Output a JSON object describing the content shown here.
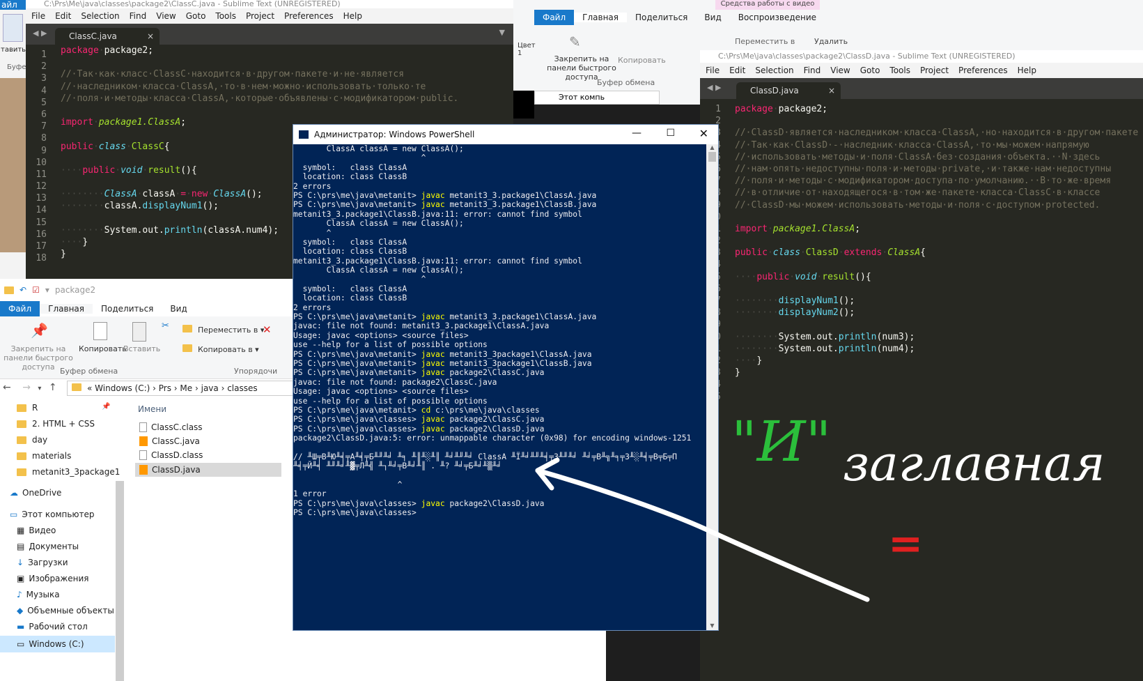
{
  "left_sublime": {
    "title": "C:\\Prs\\Me\\java\\classes\\package2\\ClassC.java - Sublime Text (UNREGISTERED)",
    "menu": [
      "File",
      "Edit",
      "Selection",
      "Find",
      "View",
      "Goto",
      "Tools",
      "Project",
      "Preferences",
      "Help"
    ],
    "tab": "ClassC.java",
    "close": "×",
    "line_numbers": [
      "1",
      "2",
      "3",
      "4",
      "5",
      "6",
      "7",
      "8",
      "9",
      "10",
      "11",
      "12",
      "13",
      "14",
      "15",
      "16",
      "17",
      "18"
    ]
  },
  "right_sublime": {
    "title": "C:\\Prs\\Me\\java\\classes\\package2\\ClassD.java - Sublime Text (UNREGISTERED)",
    "menu": [
      "File",
      "Edit",
      "Selection",
      "Find",
      "View",
      "Goto",
      "Tools",
      "Project",
      "Preferences",
      "Help"
    ],
    "tab": "ClassD.java",
    "close": "×",
    "line_numbers": [
      "1",
      "2",
      "3",
      "4",
      "5",
      "6",
      "7",
      "8",
      "9",
      "10",
      "11",
      "12",
      "13",
      "14",
      "15",
      "16",
      "17",
      "18",
      "19",
      "20",
      "21",
      "22",
      "23",
      "24",
      "25"
    ]
  },
  "top_explorer": {
    "tabs": [
      "Файл",
      "Главная",
      "Поделиться",
      "Вид"
    ],
    "video_tools": "Средства работы с видео",
    "playback": "Воспроизведение",
    "pin": "Закрепить на панели быстрого доступа",
    "copy": "Копировать",
    "clipboard": "Буфер обмена",
    "move_to": "Переместить в",
    "delete": "Удалить",
    "path": "Этот компь",
    "color": "Цвет 1"
  },
  "bottom_explorer": {
    "title": "package2",
    "tabs": [
      "Файл",
      "Главная",
      "Поделиться",
      "Вид"
    ],
    "pin": "Закрепить на панели быстрого доступа",
    "copy": "Копировать",
    "paste": "Вставить",
    "move_to": "Переместить в",
    "copy_to": "Копировать в",
    "clipboard": "Буфер обмена",
    "organize": "Упорядочи",
    "breadcrumb": [
      "Windows (C:)",
      "Prs",
      "Me",
      "java",
      "classes"
    ],
    "nav": [
      "R",
      "2. HTML + CSS",
      "day",
      "materials",
      "metanit3_3package1",
      "OneDrive",
      "Этот компьютер",
      "Видео",
      "Документы",
      "Загрузки",
      "Изображения",
      "Музыка",
      "Объемные объекты",
      "Рабочий стол",
      "Windows (C:)"
    ],
    "column_header": "Имени",
    "files": [
      "ClassC.class",
      "ClassC.java",
      "ClassD.class",
      "ClassD.java"
    ],
    "left_fragment_1": "айл",
    "left_fragment_2": "тавить",
    "left_fragment_3": "Буфе"
  },
  "powershell": {
    "title": "Администратор: Windows PowerShell",
    "lines": [
      [
        "",
        "       ClassA classA = new ClassA();"
      ],
      [
        "",
        "                           ^"
      ],
      [
        "",
        "  symbol:   class ClassA"
      ],
      [
        "",
        "  location: class ClassB"
      ],
      [
        "",
        "2 errors"
      ],
      [
        "PS C:\\prs\\me\\java\\metanit> ",
        "javac",
        " metanit3_3.package1\\ClassA.java"
      ],
      [
        "PS C:\\prs\\me\\java\\metanit> ",
        "javac",
        " metanit3_3.package1\\ClassB.java"
      ],
      [
        "",
        "metanit3_3.package1\\ClassB.java:11: error: cannot find symbol"
      ],
      [
        "",
        "       ClassA classA = new ClassA();"
      ],
      [
        "",
        "       ^"
      ],
      [
        "",
        "  symbol:   class ClassA"
      ],
      [
        "",
        "  location: class ClassB"
      ],
      [
        "",
        "metanit3_3.package1\\ClassB.java:11: error: cannot find symbol"
      ],
      [
        "",
        "       ClassA classA = new ClassA();"
      ],
      [
        "",
        "                           ^"
      ],
      [
        "",
        "  symbol:   class ClassA"
      ],
      [
        "",
        "  location: class ClassB"
      ],
      [
        "",
        "2 errors"
      ],
      [
        "PS C:\\prs\\me\\java\\metanit> ",
        "javac",
        " metanit3_3.package1\\ClassA.java"
      ],
      [
        "",
        "javac: file not found: metanit3_3.package1\\ClassA.java"
      ],
      [
        "",
        "Usage: javac <options> <source files>"
      ],
      [
        "",
        "use --help for a list of possible options"
      ],
      [
        "PS C:\\prs\\me\\java\\metanit> ",
        "javac",
        " metanit3_3package1\\ClassA.java"
      ],
      [
        "PS C:\\prs\\me\\java\\metanit> ",
        "javac",
        " metanit3_3package1\\ClassB.java"
      ],
      [
        "PS C:\\prs\\me\\java\\metanit> ",
        "javac",
        " package2\\ClassC.java"
      ],
      [
        "",
        "javac: file not found: package2\\ClassC.java"
      ],
      [
        "",
        "Usage: javac <options> <source files>"
      ],
      [
        "",
        "use --help for a list of possible options"
      ],
      [
        "PS C:\\prs\\me\\java\\metanit> ",
        "cd",
        " c:\\prs\\me\\java\\classes"
      ],
      [
        "PS C:\\prs\\me\\java\\classes> ",
        "javac",
        " package2\\ClassC.java"
      ],
      [
        "PS C:\\prs\\me\\java\\classes> ",
        "javac",
        " package2\\ClassD.java"
      ],
      [
        "",
        "package2\\ClassD.java:5: error: unmappable character (0x98) for encoding windows-1251"
      ],
      [
        "",
        ""
      ],
      [
        "",
        "// ╨Ш╤В╨Ю╨╡╤А╨╡╤Б╨╜╨╛ ╨╕ ╨║╨░╨║ ╨╛╨╜╨╛ ClassA ╨Ї╨╛╨╜╨╡╤З╨╜╨╛ ╨╛╤В╨╗╨╕╤З╨░╨╡╤В╤Б╤П"
      ],
      [
        "",
        "╨╡╤Й╨╡ ╨╜╨╛╨▓╤Л╨╣ ╨┐╨╛╤В╨╛╨║ . ╨? ╨╛╤Б╨╛╨▒╨╛"
      ],
      [
        "",
        ""
      ],
      [
        "",
        "                      ^"
      ],
      [
        "",
        "1 error"
      ],
      [
        "PS C:\\prs\\me\\java\\classes> ",
        "javac",
        " package2\\ClassD.java"
      ],
      [
        "PS C:\\prs\\me\\java\\classes> ",
        "",
        ""
      ]
    ]
  },
  "annotation": {
    "quoted_letter": "\"И\"",
    "word": "заглавная",
    "equals": "="
  },
  "colors": {
    "ps_bg": "#012456",
    "editor_bg": "#272822",
    "annotation_green": "#2bbf3b",
    "annotation_red": "#e02020"
  }
}
